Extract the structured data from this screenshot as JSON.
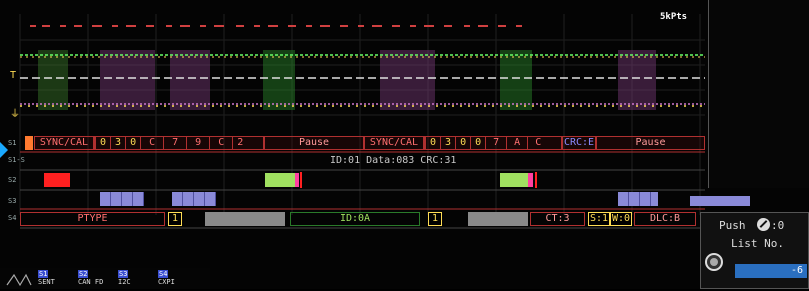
{
  "header": {
    "points_label": "5kPts"
  },
  "channels": [
    "T",
    "⏚"
  ],
  "lanes": {
    "s1": "S1",
    "s1b": "S1-S",
    "s2": "S2",
    "s3": "S3",
    "s4": "S4"
  },
  "s1_frames": {
    "sync1": "SYNC/CAL",
    "nibbles1": [
      "0",
      "3",
      "0",
      "C",
      "7",
      "9",
      "C",
      "2"
    ],
    "pause1": "Pause",
    "sync2": "SYNC/CAL",
    "nibbles2": [
      "0",
      "3",
      "0",
      "0",
      "7",
      "A",
      "C"
    ],
    "crc": "CRC:E",
    "pause2": "Pause"
  },
  "s1b_text": "ID:01 Data:083 CRC:31",
  "s4": {
    "ptype": "PTYPE",
    "one_a": "1",
    "id": "ID:0A",
    "one_b": "1",
    "ct": "CT:3",
    "s1": "S:1",
    "w0": "W:0",
    "dlc": "DLC:B"
  },
  "push_panel": {
    "push": "Push",
    "push_value": ":0",
    "list_label": "List No.",
    "list_value": "-6"
  },
  "bottom_tabs": [
    {
      "tag": "S1",
      "label": "SENT"
    },
    {
      "tag": "S2",
      "label": "CAN FD"
    },
    {
      "tag": "S3",
      "label": "I2C"
    },
    {
      "tag": "S4",
      "label": "CXPI"
    }
  ],
  "colors": {
    "s1_red": "#ff6f6f",
    "yellow": "#ffdd55",
    "s2_red": "#ff2020",
    "s2_green": "#a0e060",
    "s3_blue": "#8a8ad8",
    "accent_arrow": "#1aa9ff"
  }
}
